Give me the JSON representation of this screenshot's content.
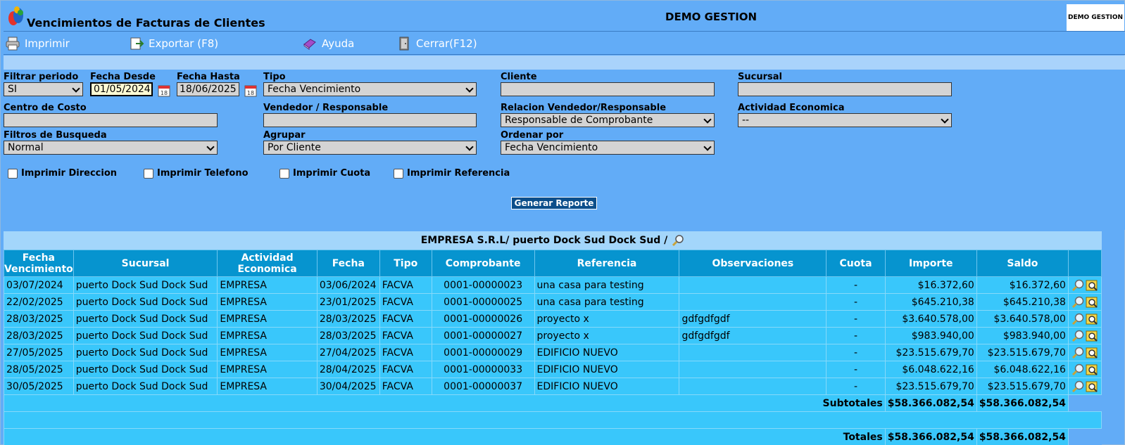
{
  "window": {
    "title": "Vencimientos de Facturas de Clientes",
    "company": "DEMO GESTION",
    "brand_text": "DEMO GESTION"
  },
  "toolbar": {
    "print": "Imprimir",
    "export": "Exportar (F8)",
    "help": "Ayuda",
    "close": "Cerrar(F12)"
  },
  "filters": {
    "filtrar_periodo": {
      "label": "Filtrar periodo",
      "value": "SI"
    },
    "fecha_desde": {
      "label": "Fecha Desde",
      "value": "01/05/2024"
    },
    "fecha_hasta": {
      "label": "Fecha Hasta",
      "value": "18/06/2025"
    },
    "tipo": {
      "label": "Tipo",
      "value": "Fecha Vencimiento"
    },
    "cliente": {
      "label": "Cliente",
      "value": ""
    },
    "sucursal": {
      "label": "Sucursal",
      "value": ""
    },
    "centro_costo": {
      "label": "Centro de Costo",
      "value": ""
    },
    "vendedor": {
      "label": "Vendedor / Responsable",
      "value": ""
    },
    "relacion": {
      "label": "Relacion Vendedor/Responsable",
      "value": "Responsable de Comprobante"
    },
    "actividad": {
      "label": "Actividad Economica",
      "value": "--"
    },
    "filtros_busqueda": {
      "label": "Filtros de Busqueda",
      "value": "Normal"
    },
    "agrupar": {
      "label": "Agrupar",
      "value": "Por Cliente"
    },
    "ordenar": {
      "label": "Ordenar por",
      "value": "Fecha Vencimiento"
    },
    "checks": {
      "direccion": "Imprimir Direccion",
      "telefono": "Imprimir Telefono",
      "cuota": "Imprimir Cuota",
      "referencia": "Imprimir Referencia"
    },
    "generate_button": "Generar Reporte"
  },
  "group": {
    "title": "EMPRESA S.R.L/ puerto Dock Sud Dock Sud /"
  },
  "table": {
    "headers": {
      "fecha_venc_1": "Fecha",
      "fecha_venc_2": "Vencimiento",
      "sucursal": "Sucursal",
      "actividad_1": "Actividad",
      "actividad_2": "Economica",
      "fecha": "Fecha",
      "tipo": "Tipo",
      "comprobante": "Comprobante",
      "referencia": "Referencia",
      "observaciones": "Observaciones",
      "cuota": "Cuota",
      "importe": "Importe",
      "saldo": "Saldo"
    },
    "rows": [
      {
        "venc": "03/07/2024",
        "sucursal": "puerto Dock Sud Dock Sud",
        "actividad": "EMPRESA",
        "fecha": "03/06/2024",
        "tipo": "FACVA",
        "comprobante": "0001-00000023",
        "referencia": "una casa para testing",
        "observaciones": "",
        "cuota": "-",
        "importe": "$16.372,60",
        "saldo": "$16.372,60"
      },
      {
        "venc": "22/02/2025",
        "sucursal": "puerto Dock Sud Dock Sud",
        "actividad": "EMPRESA",
        "fecha": "23/01/2025",
        "tipo": "FACVA",
        "comprobante": "0001-00000025",
        "referencia": "una casa para testing",
        "observaciones": "",
        "cuota": "-",
        "importe": "$645.210,38",
        "saldo": "$645.210,38"
      },
      {
        "venc": "28/03/2025",
        "sucursal": "puerto Dock Sud Dock Sud",
        "actividad": "EMPRESA",
        "fecha": "28/03/2025",
        "tipo": "FACVA",
        "comprobante": "0001-00000026",
        "referencia": "proyecto x",
        "observaciones": "gdfgdfgdf",
        "cuota": "-",
        "importe": "$3.640.578,00",
        "saldo": "$3.640.578,00"
      },
      {
        "venc": "28/03/2025",
        "sucursal": "puerto Dock Sud Dock Sud",
        "actividad": "EMPRESA",
        "fecha": "28/03/2025",
        "tipo": "FACVA",
        "comprobante": "0001-00000027",
        "referencia": "proyecto x",
        "observaciones": "gdfgdfgdf",
        "cuota": "-",
        "importe": "$983.940,00",
        "saldo": "$983.940,00"
      },
      {
        "venc": "27/05/2025",
        "sucursal": "puerto Dock Sud Dock Sud",
        "actividad": "EMPRESA",
        "fecha": "27/04/2025",
        "tipo": "FACVA",
        "comprobante": "0001-00000029",
        "referencia": "EDIFICIO NUEVO",
        "observaciones": "",
        "cuota": "-",
        "importe": "$23.515.679,70",
        "saldo": "$23.515.679,70"
      },
      {
        "venc": "28/05/2025",
        "sucursal": "puerto Dock Sud Dock Sud",
        "actividad": "EMPRESA",
        "fecha": "28/04/2025",
        "tipo": "FACVA",
        "comprobante": "0001-00000033",
        "referencia": "EDIFICIO NUEVO",
        "observaciones": "",
        "cuota": "-",
        "importe": "$6.048.622,16",
        "saldo": "$6.048.622,16"
      },
      {
        "venc": "30/05/2025",
        "sucursal": "puerto Dock Sud Dock Sud",
        "actividad": "EMPRESA",
        "fecha": "30/04/2025",
        "tipo": "FACVA",
        "comprobante": "0001-00000037",
        "referencia": "EDIFICIO NUEVO",
        "observaciones": "",
        "cuota": "-",
        "importe": "$23.515.679,70",
        "saldo": "$23.515.679,70"
      }
    ],
    "subtotals": {
      "label": "Subtotales",
      "importe": "$58.366.082,54",
      "saldo": "$58.366.082,54"
    },
    "totals": {
      "label": "Totales",
      "importe": "$58.366.082,54",
      "saldo": "$58.366.082,54"
    }
  }
}
